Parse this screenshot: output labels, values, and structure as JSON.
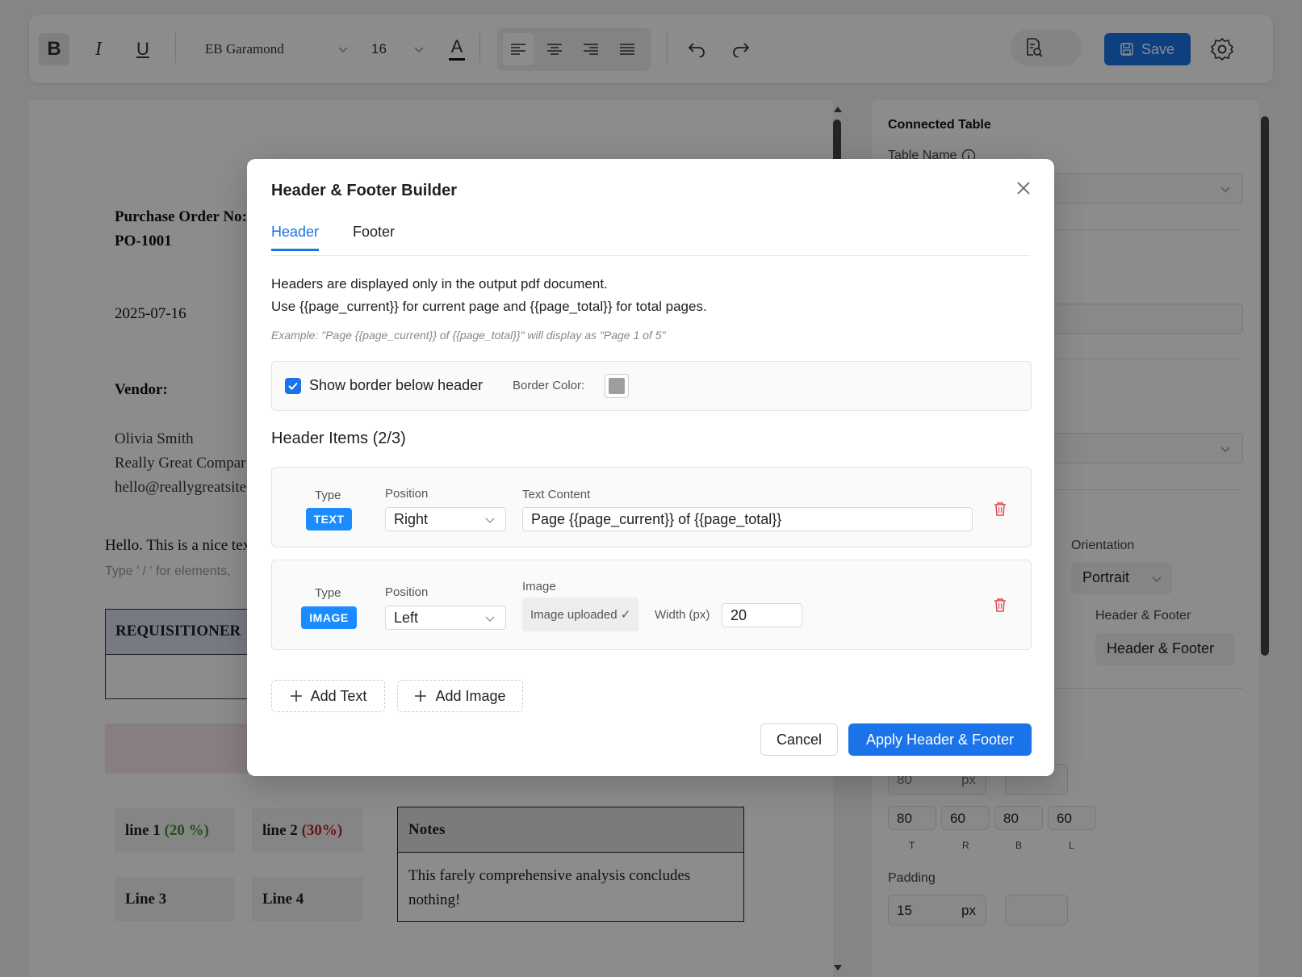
{
  "toolbar": {
    "bold_label": "B",
    "italic_label": "I",
    "underline_label": "U",
    "font_family": "EB Garamond",
    "font_size": "16",
    "text_color_label": "A",
    "save_label": "Save"
  },
  "document": {
    "po_label": "Purchase Order No:",
    "po_number": "PO-1001",
    "date": "2025-07-16",
    "vendor_label": "Vendor:",
    "vendor_name": "Olivia Smith",
    "vendor_company": "Really Great Compar",
    "vendor_email": "hello@reallygreatsite.c",
    "intro_text": "Hello. This is a nice tex",
    "hint_text": "Type ' / ' for elements,",
    "requisitioner_header": "REQUISITIONER",
    "line1_label": "line 1",
    "line1_pct": "(20 %)",
    "line2_label": "line 2",
    "line2_pct": "(30%)",
    "line3_label": "Line 3",
    "line4_label": "Line 4",
    "notes_header": "Notes",
    "notes_body": "This farely comprehensive analysis concludes nothing!"
  },
  "panel": {
    "connected_table": "Connected Table",
    "table_name_label": "Table Name",
    "orientation_label": "Orientation",
    "orientation_value": "Portrait",
    "hf_label": "Header & Footer",
    "hf_button": "Header & Footer",
    "margin_value": "80",
    "margin_unit": "px",
    "margins": [
      "80",
      "60",
      "80",
      "60"
    ],
    "margin_sides": [
      "T",
      "R",
      "B",
      "L"
    ],
    "padding_label": "Padding",
    "padding_value": "15",
    "padding_unit": "px"
  },
  "modal": {
    "title": "Header & Footer Builder",
    "tabs": [
      "Header",
      "Footer"
    ],
    "desc_line1": "Headers are displayed only in the output pdf document.",
    "desc_line2": "Use {{page_current}} for current page and {{page_total}} for total pages.",
    "example": "Example: \"Page {{page_current}} of {{page_total}}\" will display as \"Page 1 of 5\"",
    "show_border_label": "Show border below header",
    "border_color_label": "Border Color:",
    "border_color": "#9e9e9e",
    "items_title": "Header Items (2/3)",
    "items": [
      {
        "type_label": "Type",
        "type": "TEXT",
        "position_label": "Position",
        "position": "Right",
        "content_label": "Text Content",
        "content": "Page {{page_current}} of {{page_total}}"
      },
      {
        "type_label": "Type",
        "type": "IMAGE",
        "position_label": "Position",
        "position": "Left",
        "image_label": "Image",
        "image_status": "Image uploaded ✓",
        "width_label": "Width (px)",
        "width": "20"
      }
    ],
    "add_text": "Add Text",
    "add_image": "Add Image",
    "cancel": "Cancel",
    "apply": "Apply Header & Footer"
  }
}
